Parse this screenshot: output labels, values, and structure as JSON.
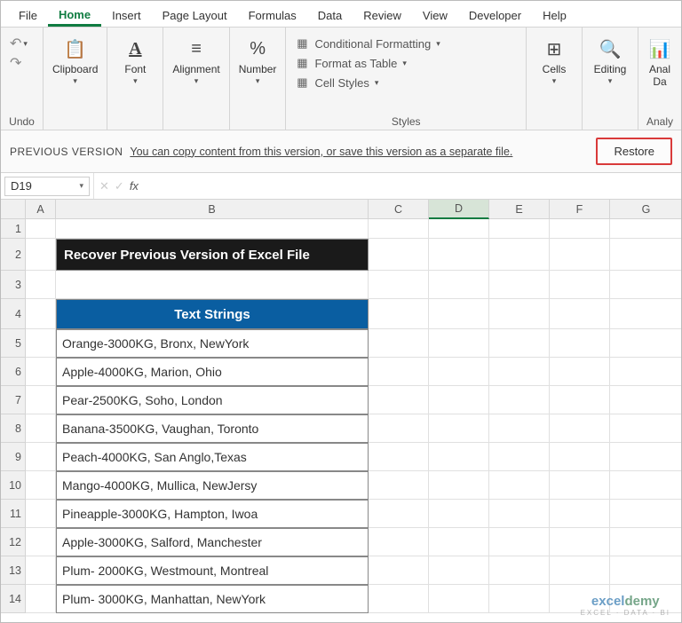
{
  "tabs": [
    "File",
    "Home",
    "Insert",
    "Page Layout",
    "Formulas",
    "Data",
    "Review",
    "View",
    "Developer",
    "Help"
  ],
  "activeTab": "Home",
  "ribbon": {
    "undo": {
      "label": "Undo"
    },
    "clipboard": {
      "label": "Clipboard"
    },
    "font": {
      "label": "Font"
    },
    "alignment": {
      "label": "Alignment"
    },
    "number": {
      "label": "Number"
    },
    "styles": {
      "label": "Styles",
      "condFmt": "Conditional Formatting",
      "fmtTable": "Format as Table",
      "cellStyles": "Cell Styles"
    },
    "cells": {
      "label": "Cells"
    },
    "editing": {
      "label": "Editing"
    },
    "analysis": {
      "label": "Analy",
      "line1": "Anal",
      "line2": "Da"
    }
  },
  "messageBar": {
    "title": "PREVIOUS VERSION",
    "text": "You can copy content from this version, or save this version as a separate file.",
    "restore": "Restore"
  },
  "nameBox": "D19",
  "formula": "",
  "columns": [
    "A",
    "B",
    "C",
    "D",
    "E",
    "F",
    "G"
  ],
  "selectedCol": "D",
  "rows": [
    "1",
    "2",
    "3",
    "4",
    "5",
    "6",
    "7",
    "8",
    "9",
    "10",
    "11",
    "12",
    "13",
    "14"
  ],
  "titleCell": "Recover Previous Version of Excel File",
  "tableHeader": "Text Strings",
  "dataRows": [
    "Orange-3000KG, Bronx, NewYork",
    "Apple-4000KG, Marion, Ohio",
    "Pear-2500KG, Soho, London",
    "Banana-3500KG, Vaughan, Toronto",
    "Peach-4000KG, San Anglo,Texas",
    "Mango-4000KG, Mullica, NewJersy",
    "Pineapple-3000KG, Hampton, Iwoa",
    "Apple-3000KG, Salford, Manchester",
    "Plum- 2000KG, Westmount, Montreal",
    "Plum- 3000KG, Manhattan, NewYork"
  ],
  "watermark": {
    "brand1": "excel",
    "brand2": "demy",
    "tag": "EXCEL · DATA · BI"
  }
}
